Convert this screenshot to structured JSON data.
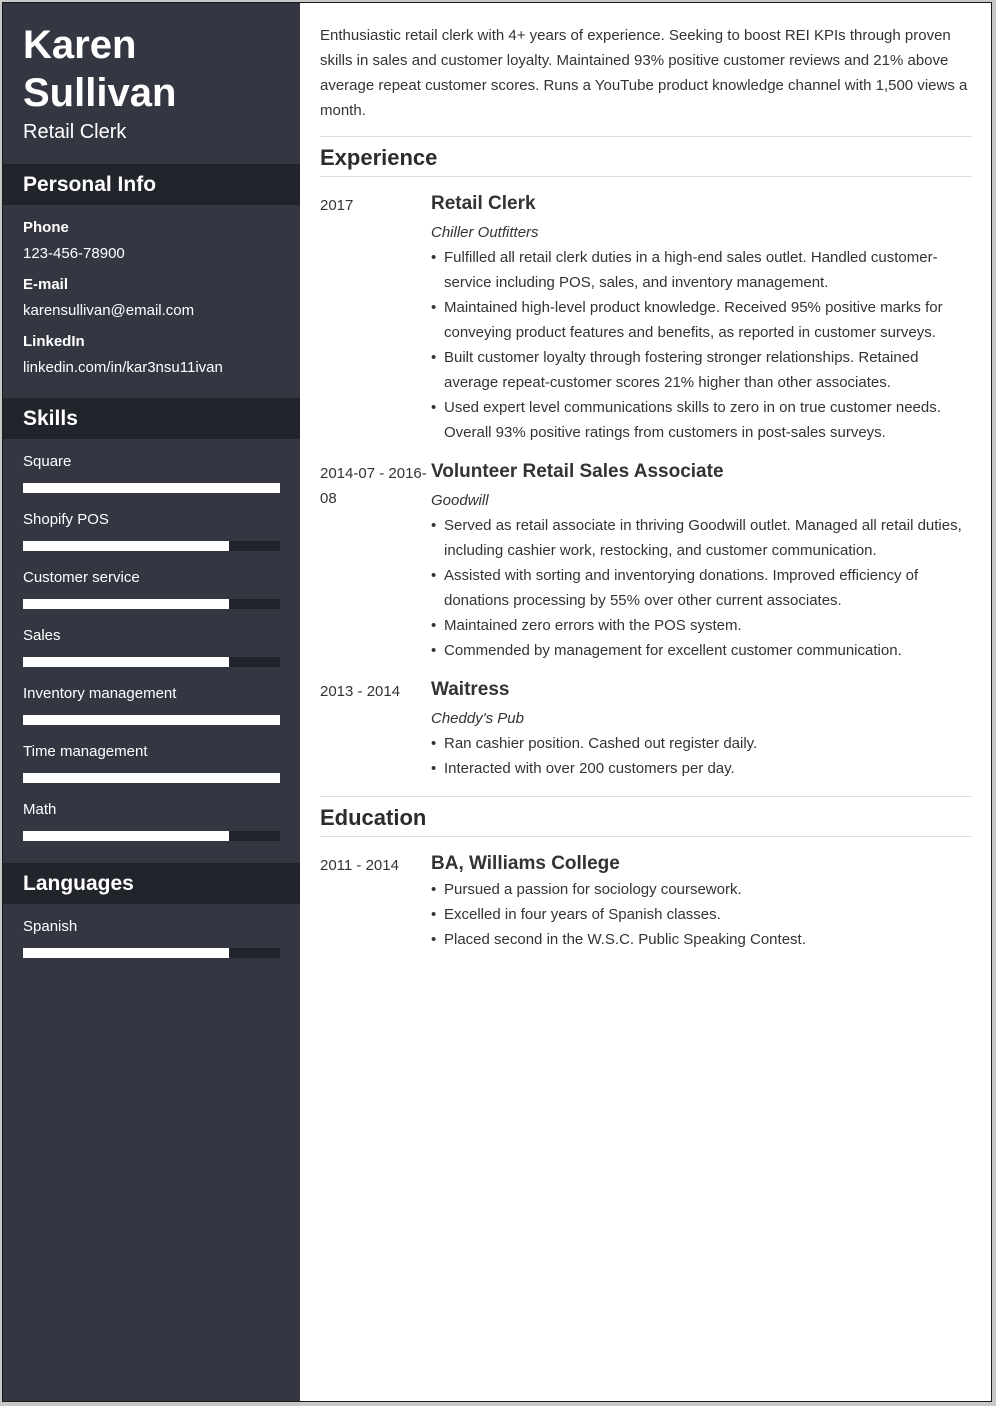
{
  "header": {
    "first_name": "Karen",
    "last_name": "Sullivan",
    "role": "Retail Clerk"
  },
  "personal_info": {
    "heading": "Personal Info",
    "items": [
      {
        "label": "Phone",
        "value": "123-456-78900"
      },
      {
        "label": "E-mail",
        "value": "karensullivan@email.com"
      },
      {
        "label": "LinkedIn",
        "value": "linkedin.com/in/kar3nsu11ivan"
      }
    ]
  },
  "skills": {
    "heading": "Skills",
    "items": [
      {
        "name": "Square",
        "level": 1.0
      },
      {
        "name": "Shopify POS",
        "level": 0.8
      },
      {
        "name": "Customer service",
        "level": 0.8
      },
      {
        "name": "Sales",
        "level": 0.8
      },
      {
        "name": "Inventory management",
        "level": 1.0
      },
      {
        "name": "Time management",
        "level": 1.0
      },
      {
        "name": "Math",
        "level": 0.8
      }
    ]
  },
  "languages": {
    "heading": "Languages",
    "items": [
      {
        "name": "Spanish",
        "level": 0.8
      }
    ]
  },
  "summary": "Enthusiastic retail clerk with 4+ years of experience. Seeking to boost REI KPIs through proven skills in sales and customer loyalty. Maintained 93% positive customer reviews and 21% above average repeat customer scores. Runs a YouTube product knowledge channel with 1,500 views a month.",
  "experience": {
    "heading": "Experience",
    "entries": [
      {
        "date": "2017",
        "title": "Retail Clerk",
        "company": "Chiller Outfitters",
        "bullets": [
          "Fulfilled all retail clerk duties in a high-end sales outlet. Handled customer-service including POS, sales, and inventory management.",
          "Maintained high-level product knowledge. Received 95% positive marks for conveying product features and benefits, as reported in customer surveys.",
          "Built customer loyalty through fostering stronger relationships. Retained average repeat-customer scores 21% higher than other associates.",
          "Used expert level communications skills to zero in on true customer needs. Overall 93% positive ratings from customers in post-sales surveys."
        ]
      },
      {
        "date": "2014-07 - 2016-08",
        "title": "Volunteer Retail Sales Associate",
        "company": "Goodwill",
        "bullets": [
          "Served as retail associate in thriving Goodwill outlet. Managed all retail duties, including cashier work, restocking, and customer communication.",
          "Assisted with sorting and inventorying donations. Improved efficiency of donations processing by 55% over other current associates.",
          "Maintained zero errors with the POS system.",
          "Commended by management for excellent customer communication."
        ]
      },
      {
        "date": "2013 - 2014",
        "title": "Waitress",
        "company": "Cheddy's Pub",
        "bullets": [
          "Ran cashier position. Cashed out register daily.",
          "Interacted with over 200 customers per day."
        ]
      }
    ]
  },
  "education": {
    "heading": "Education",
    "entries": [
      {
        "date": "2011 - 2014",
        "title": "BA, Williams College",
        "bullets": [
          "Pursued a passion for sociology coursework.",
          "Excelled in four years of Spanish classes.",
          "Placed second in the W.S.C. Public Speaking Contest."
        ]
      }
    ]
  }
}
